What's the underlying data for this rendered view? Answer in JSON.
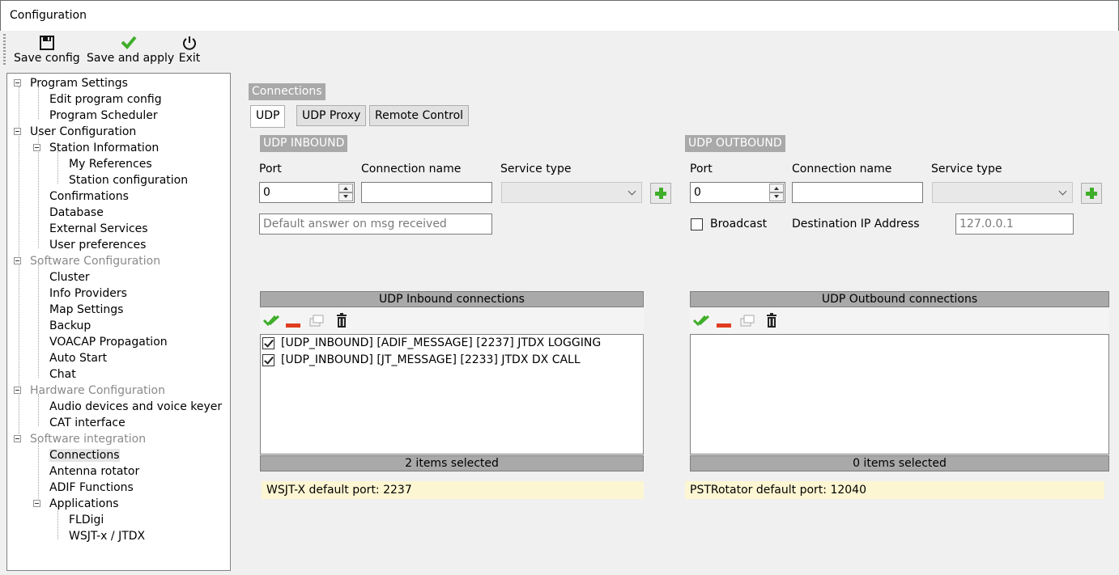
{
  "window": {
    "title": "Configuration"
  },
  "toolbar": {
    "save_config": "Save config",
    "save_apply": "Save and apply",
    "exit": "Exit"
  },
  "tree": {
    "program_settings": "Program Settings",
    "edit_program_config": "Edit program config",
    "program_scheduler": "Program Scheduler",
    "user_configuration": "User Configuration",
    "station_information": "Station Information",
    "my_references": "My References",
    "station_configuration": "Station configuration",
    "confirmations": "Confirmations",
    "database": "Database",
    "external_services": "External Services",
    "user_preferences": "User preferences",
    "software_configuration": "Software Configuration",
    "cluster": "Cluster",
    "info_providers": "Info Providers",
    "map_settings": "Map Settings",
    "backup": "Backup",
    "voacap": "VOACAP Propagation",
    "auto_start": "Auto Start",
    "chat": "Chat",
    "hardware_configuration": "Hardware Configuration",
    "audio_devices": "Audio devices and voice keyer",
    "cat_interface": "CAT interface",
    "software_integration": "Software integration",
    "connections": "Connections",
    "antenna_rotator": "Antenna rotator",
    "adif_functions": "ADIF Functions",
    "applications": "Applications",
    "fldigi": "FLDigi",
    "wsjtx": "WSJT-x / JTDX"
  },
  "main": {
    "section_title": "Connections",
    "tabs": {
      "udp": "UDP",
      "udp_proxy": "UDP Proxy",
      "remote_control": "Remote Control"
    },
    "inbound": {
      "header": "UDP INBOUND",
      "port_label": "Port",
      "name_label": "Connection name",
      "service_label": "Service type",
      "port_value": "0",
      "name_value": "",
      "default_answer_placeholder": "Default answer on msg received",
      "list_title": "UDP Inbound connections",
      "items": [
        "[UDP_INBOUND] [ADIF_MESSAGE] [2237] JTDX LOGGING",
        "[UDP_INBOUND] [JT_MESSAGE] [2233] JTDX DX CALL"
      ],
      "footer": "2 items selected",
      "info": "WSJT-X default port: 2237"
    },
    "outbound": {
      "header": "UDP OUTBOUND",
      "port_label": "Port",
      "name_label": "Connection name",
      "service_label": "Service type",
      "port_value": "0",
      "name_value": "",
      "broadcast_label": "Broadcast",
      "dest_ip_label": "Destination IP Address",
      "dest_ip_value": "127.0.0.1",
      "list_title": "UDP Outbound connections",
      "footer": "0 items selected",
      "info": "PSTRotator default port: 12040"
    }
  },
  "colors": {
    "header_gray": "#a9a9a9",
    "info_yellow": "#fdf6d2",
    "check_green": "#3fae2a",
    "minus_red": "#e03c1f"
  }
}
